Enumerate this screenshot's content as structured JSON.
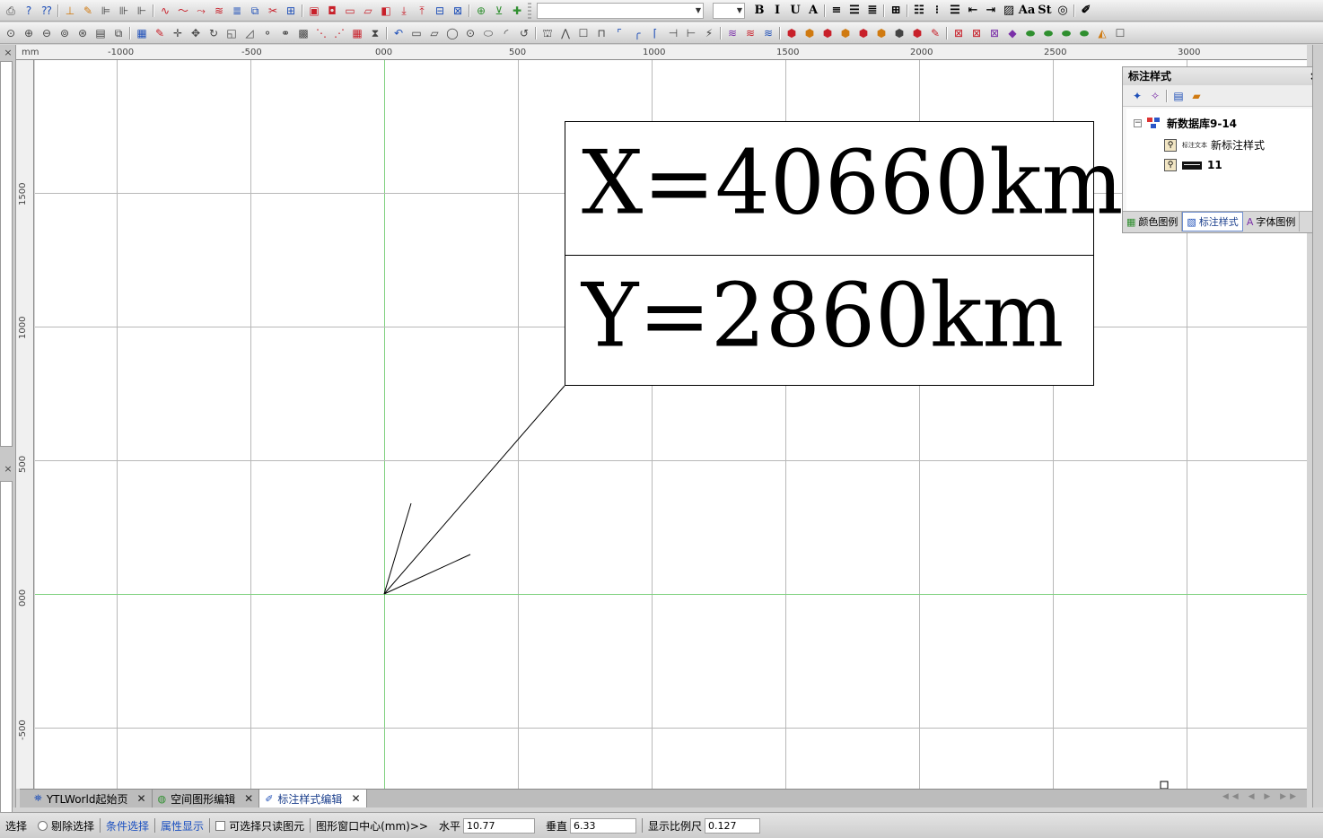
{
  "toolbars": {
    "row1": [
      {
        "icon": "print-icon",
        "glyph": "⎙",
        "color": "gray"
      },
      {
        "icon": "help-icon",
        "glyph": "?",
        "color": "blue"
      },
      {
        "icon": "context-help-icon",
        "glyph": "⁇",
        "color": "blue"
      },
      {
        "sep": true
      },
      {
        "icon": "point-insert-icon",
        "glyph": "⊥",
        "color": "orange"
      },
      {
        "icon": "point-edit-icon",
        "glyph": "✎",
        "color": "orange"
      },
      {
        "icon": "point-param-icon",
        "glyph": "⊫",
        "color": "gray"
      },
      {
        "icon": "point-copy-icon",
        "glyph": "⊪",
        "color": "gray"
      },
      {
        "icon": "point-align-icon",
        "glyph": "⊩",
        "color": "gray"
      },
      {
        "sep": true
      },
      {
        "icon": "line-draw-icon",
        "glyph": "∿",
        "color": "red"
      },
      {
        "icon": "line-curve-icon",
        "glyph": "〜",
        "color": "red"
      },
      {
        "icon": "line-edit-icon",
        "glyph": "⤳",
        "color": "red"
      },
      {
        "icon": "line-wave-icon",
        "glyph": "≋",
        "color": "red"
      },
      {
        "icon": "line-param-icon",
        "glyph": "≣",
        "color": "blue"
      },
      {
        "icon": "line-copy-icon",
        "glyph": "⧉",
        "color": "blue"
      },
      {
        "icon": "line-cut-icon",
        "glyph": "✂",
        "color": "red"
      },
      {
        "icon": "line-props-icon",
        "glyph": "⊞",
        "color": "blue"
      },
      {
        "sep": true
      },
      {
        "icon": "area-input-icon",
        "glyph": "▣",
        "color": "red"
      },
      {
        "icon": "area-multi-icon",
        "glyph": "◘",
        "color": "red"
      },
      {
        "icon": "area-rect-icon",
        "glyph": "▭",
        "color": "red"
      },
      {
        "icon": "area-poly-icon",
        "glyph": "▱",
        "color": "red"
      },
      {
        "icon": "area-clip-icon",
        "glyph": "◧",
        "color": "red"
      },
      {
        "icon": "area-down-icon",
        "glyph": "⤓",
        "color": "red"
      },
      {
        "icon": "area-up-icon",
        "glyph": "⤒",
        "color": "red"
      },
      {
        "icon": "area-merge-icon",
        "glyph": "⊟",
        "color": "blue"
      },
      {
        "icon": "area-split-icon",
        "glyph": "⊠",
        "color": "blue"
      },
      {
        "sep": true
      },
      {
        "icon": "label-add-icon",
        "glyph": "⊕",
        "color": "green"
      },
      {
        "icon": "label-down-icon",
        "glyph": "⊻",
        "color": "green"
      },
      {
        "icon": "label-plus-icon",
        "glyph": "✚",
        "color": "green"
      }
    ],
    "row1_right": [
      {
        "icon": "bold-icon",
        "glyph": "B"
      },
      {
        "icon": "italic-icon",
        "glyph": "I"
      },
      {
        "icon": "underline-icon",
        "glyph": "U"
      },
      {
        "icon": "font-color-icon",
        "glyph": "A"
      },
      {
        "sep": true
      },
      {
        "icon": "align-left-icon",
        "glyph": "≡"
      },
      {
        "icon": "align-center-icon",
        "glyph": "☰"
      },
      {
        "icon": "align-right-icon",
        "glyph": "≣"
      },
      {
        "sep": true
      },
      {
        "icon": "border-icon",
        "glyph": "⊞"
      },
      {
        "sep": true
      },
      {
        "icon": "list-bullets-icon",
        "glyph": "☷"
      },
      {
        "icon": "list-numbers-icon",
        "glyph": "⁝"
      },
      {
        "icon": "list-plain-icon",
        "glyph": "☰"
      },
      {
        "icon": "outdent-icon",
        "glyph": "⇤"
      },
      {
        "icon": "indent-icon",
        "glyph": "⇥"
      },
      {
        "icon": "picture-icon",
        "glyph": "▨"
      },
      {
        "icon": "superscript-icon",
        "glyph": "Aa"
      },
      {
        "icon": "strike-icon",
        "glyph": "St"
      },
      {
        "icon": "globe-icon",
        "glyph": "◎"
      },
      {
        "sep": true
      },
      {
        "icon": "pen-icon",
        "glyph": "✐"
      }
    ],
    "row2": [
      {
        "icon": "zoom-window-icon",
        "glyph": "⊙",
        "color": "gray"
      },
      {
        "icon": "zoom-in-icon",
        "glyph": "⊕",
        "color": "gray"
      },
      {
        "icon": "zoom-out-icon",
        "glyph": "⊖",
        "color": "gray"
      },
      {
        "icon": "zoom-real-icon",
        "glyph": "⊚",
        "color": "gray"
      },
      {
        "icon": "zoom-all-icon",
        "glyph": "⊛",
        "color": "gray"
      },
      {
        "icon": "view-page-icon",
        "glyph": "▤",
        "color": "gray"
      },
      {
        "icon": "view-layer-icon",
        "glyph": "⧉",
        "color": "gray"
      },
      {
        "sep": true
      },
      {
        "icon": "select-icon",
        "glyph": "▦",
        "color": "blue"
      },
      {
        "icon": "brush-icon",
        "glyph": "✎",
        "color": "red"
      },
      {
        "icon": "crosshair-icon",
        "glyph": "✛",
        "color": "gray"
      },
      {
        "icon": "move-icon",
        "glyph": "✥",
        "color": "gray"
      },
      {
        "icon": "rotate-icon",
        "glyph": "↻",
        "color": "gray"
      },
      {
        "icon": "scale-icon",
        "glyph": "◱",
        "color": "gray"
      },
      {
        "icon": "skew-icon",
        "glyph": "◿",
        "color": "gray"
      },
      {
        "icon": "node-icon",
        "glyph": "⚬",
        "color": "gray"
      },
      {
        "icon": "node-move-icon",
        "glyph": "⚭",
        "color": "gray"
      },
      {
        "icon": "grid-icon",
        "glyph": "▩",
        "color": "gray"
      },
      {
        "icon": "vertex-icon",
        "glyph": "⋱",
        "color": "red"
      },
      {
        "icon": "vertex-edit-icon",
        "glyph": "⋰",
        "color": "red"
      },
      {
        "icon": "table-icon",
        "glyph": "▦",
        "color": "red"
      },
      {
        "icon": "mirror-icon",
        "glyph": "⧗",
        "color": "gray"
      },
      {
        "sep": true
      },
      {
        "icon": "undo-icon",
        "glyph": "↶",
        "color": "blue"
      },
      {
        "icon": "rect-icon",
        "glyph": "▭",
        "color": "gray"
      },
      {
        "icon": "parallelogram-icon",
        "glyph": "▱",
        "color": "gray"
      },
      {
        "icon": "circle-icon",
        "glyph": "◯",
        "color": "gray"
      },
      {
        "icon": "circle-center-icon",
        "glyph": "⊙",
        "color": "gray"
      },
      {
        "icon": "ellipse-icon",
        "glyph": "⬭",
        "color": "gray"
      },
      {
        "icon": "arc-icon",
        "glyph": "◜",
        "color": "gray"
      },
      {
        "icon": "arc-curve-icon",
        "glyph": "↺",
        "color": "gray"
      },
      {
        "sep": true
      },
      {
        "icon": "stamp-icon",
        "glyph": "⛫",
        "color": "gray"
      },
      {
        "icon": "polyline-icon",
        "glyph": "⋀",
        "color": "gray"
      },
      {
        "icon": "box-icon",
        "glyph": "☐",
        "color": "gray"
      },
      {
        "icon": "box-open-icon",
        "glyph": "⊓",
        "color": "gray"
      },
      {
        "icon": "corner-icon",
        "glyph": "⌜",
        "color": "blue"
      },
      {
        "icon": "corner-round-icon",
        "glyph": "╭",
        "color": "blue"
      },
      {
        "icon": "fillet-icon",
        "glyph": "⌈",
        "color": "blue"
      },
      {
        "icon": "trim-icon",
        "glyph": "⊣",
        "color": "gray"
      },
      {
        "icon": "extend-icon",
        "glyph": "⊢",
        "color": "gray"
      },
      {
        "icon": "break-icon",
        "glyph": "⚡",
        "color": "gray"
      },
      {
        "sep": true
      },
      {
        "icon": "layers-a-icon",
        "glyph": "≋",
        "color": "purple"
      },
      {
        "icon": "layers-b-icon",
        "glyph": "≋",
        "color": "red"
      },
      {
        "icon": "layers-c-icon",
        "glyph": "≋",
        "color": "blue"
      },
      {
        "sep": true
      },
      {
        "icon": "attr-a-icon",
        "glyph": "⬢",
        "color": "red"
      },
      {
        "icon": "attr-b-icon",
        "glyph": "⬢",
        "color": "orange"
      },
      {
        "icon": "attr-c-icon",
        "glyph": "⬢",
        "color": "red"
      },
      {
        "icon": "attr-d-icon",
        "glyph": "⬢",
        "color": "orange"
      },
      {
        "icon": "attr-e-icon",
        "glyph": "⬢",
        "color": "red"
      },
      {
        "icon": "attr-f-icon",
        "glyph": "⬢",
        "color": "orange"
      },
      {
        "icon": "attr-g-icon",
        "glyph": "⬢",
        "color": "gray"
      },
      {
        "icon": "attr-h-icon",
        "glyph": "⬢",
        "color": "red"
      },
      {
        "icon": "attr-i-icon",
        "glyph": "✎",
        "color": "red"
      },
      {
        "sep": true
      },
      {
        "icon": "net-a-icon",
        "glyph": "⊠",
        "color": "red"
      },
      {
        "icon": "net-b-icon",
        "glyph": "⊠",
        "color": "red"
      },
      {
        "icon": "net-c-icon",
        "glyph": "⊠",
        "color": "purple"
      },
      {
        "icon": "color-a-icon",
        "glyph": "◆",
        "color": "purple"
      },
      {
        "icon": "color-b-icon",
        "glyph": "⬬",
        "color": "green"
      },
      {
        "icon": "color-c-icon",
        "glyph": "⬬",
        "color": "green"
      },
      {
        "icon": "color-d-icon",
        "glyph": "⬬",
        "color": "green"
      },
      {
        "icon": "color-e-icon",
        "glyph": "⬬",
        "color": "green"
      },
      {
        "icon": "color-f-icon",
        "glyph": "◭",
        "color": "orange"
      },
      {
        "icon": "color-g-icon",
        "glyph": "☐",
        "color": "gray"
      }
    ]
  },
  "ruler": {
    "unit": "mm",
    "top_labels": [
      "-1000",
      "-500",
      "000",
      "500",
      "1000",
      "1500",
      "2000",
      "2500",
      "3000"
    ],
    "left_labels": [
      "1500",
      "1000",
      "500",
      "000",
      "-500"
    ]
  },
  "label": {
    "x_text": "X=40660km",
    "y_text": "Y=2860km"
  },
  "style_panel": {
    "title": "标注样式",
    "close": "×",
    "tree": {
      "root": "新数据库9-14",
      "root_toggle": "−",
      "items": [
        {
          "sample": "标注文本",
          "label": "新标注样式"
        },
        {
          "label": "11"
        }
      ]
    },
    "tabs": [
      {
        "icon": "color-legend-icon",
        "label": "颜色图例",
        "active": false
      },
      {
        "icon": "label-style-icon",
        "label": "标注样式",
        "active": true
      },
      {
        "icon": "font-legend-icon",
        "label": "字体图例",
        "active": false
      }
    ]
  },
  "doc_tabs": [
    {
      "icon": "start-page-icon",
      "label": "YTLWorld起始页",
      "active": false
    },
    {
      "icon": "globe-icon",
      "label": "空间图形编辑",
      "active": false
    },
    {
      "icon": "label-edit-icon",
      "label": "标注样式编辑",
      "active": true
    }
  ],
  "status_bar": {
    "select": "选择",
    "deselect": "剔除选择",
    "condition_select": "条件选择",
    "attr_display": "属性显示",
    "readonly_select": "可选择只读图元",
    "center_label": "图形窗口中心(mm)>>",
    "horizontal_label": "水平",
    "horizontal_value": "10.77",
    "vertical_label": "垂直",
    "vertical_value": "6.33",
    "scale_label": "显示比例尺",
    "scale_value": "0.127"
  },
  "colors": {
    "grid": "#b8b8b8",
    "axis": "#7fd17f",
    "link": "#1a4fc0"
  }
}
